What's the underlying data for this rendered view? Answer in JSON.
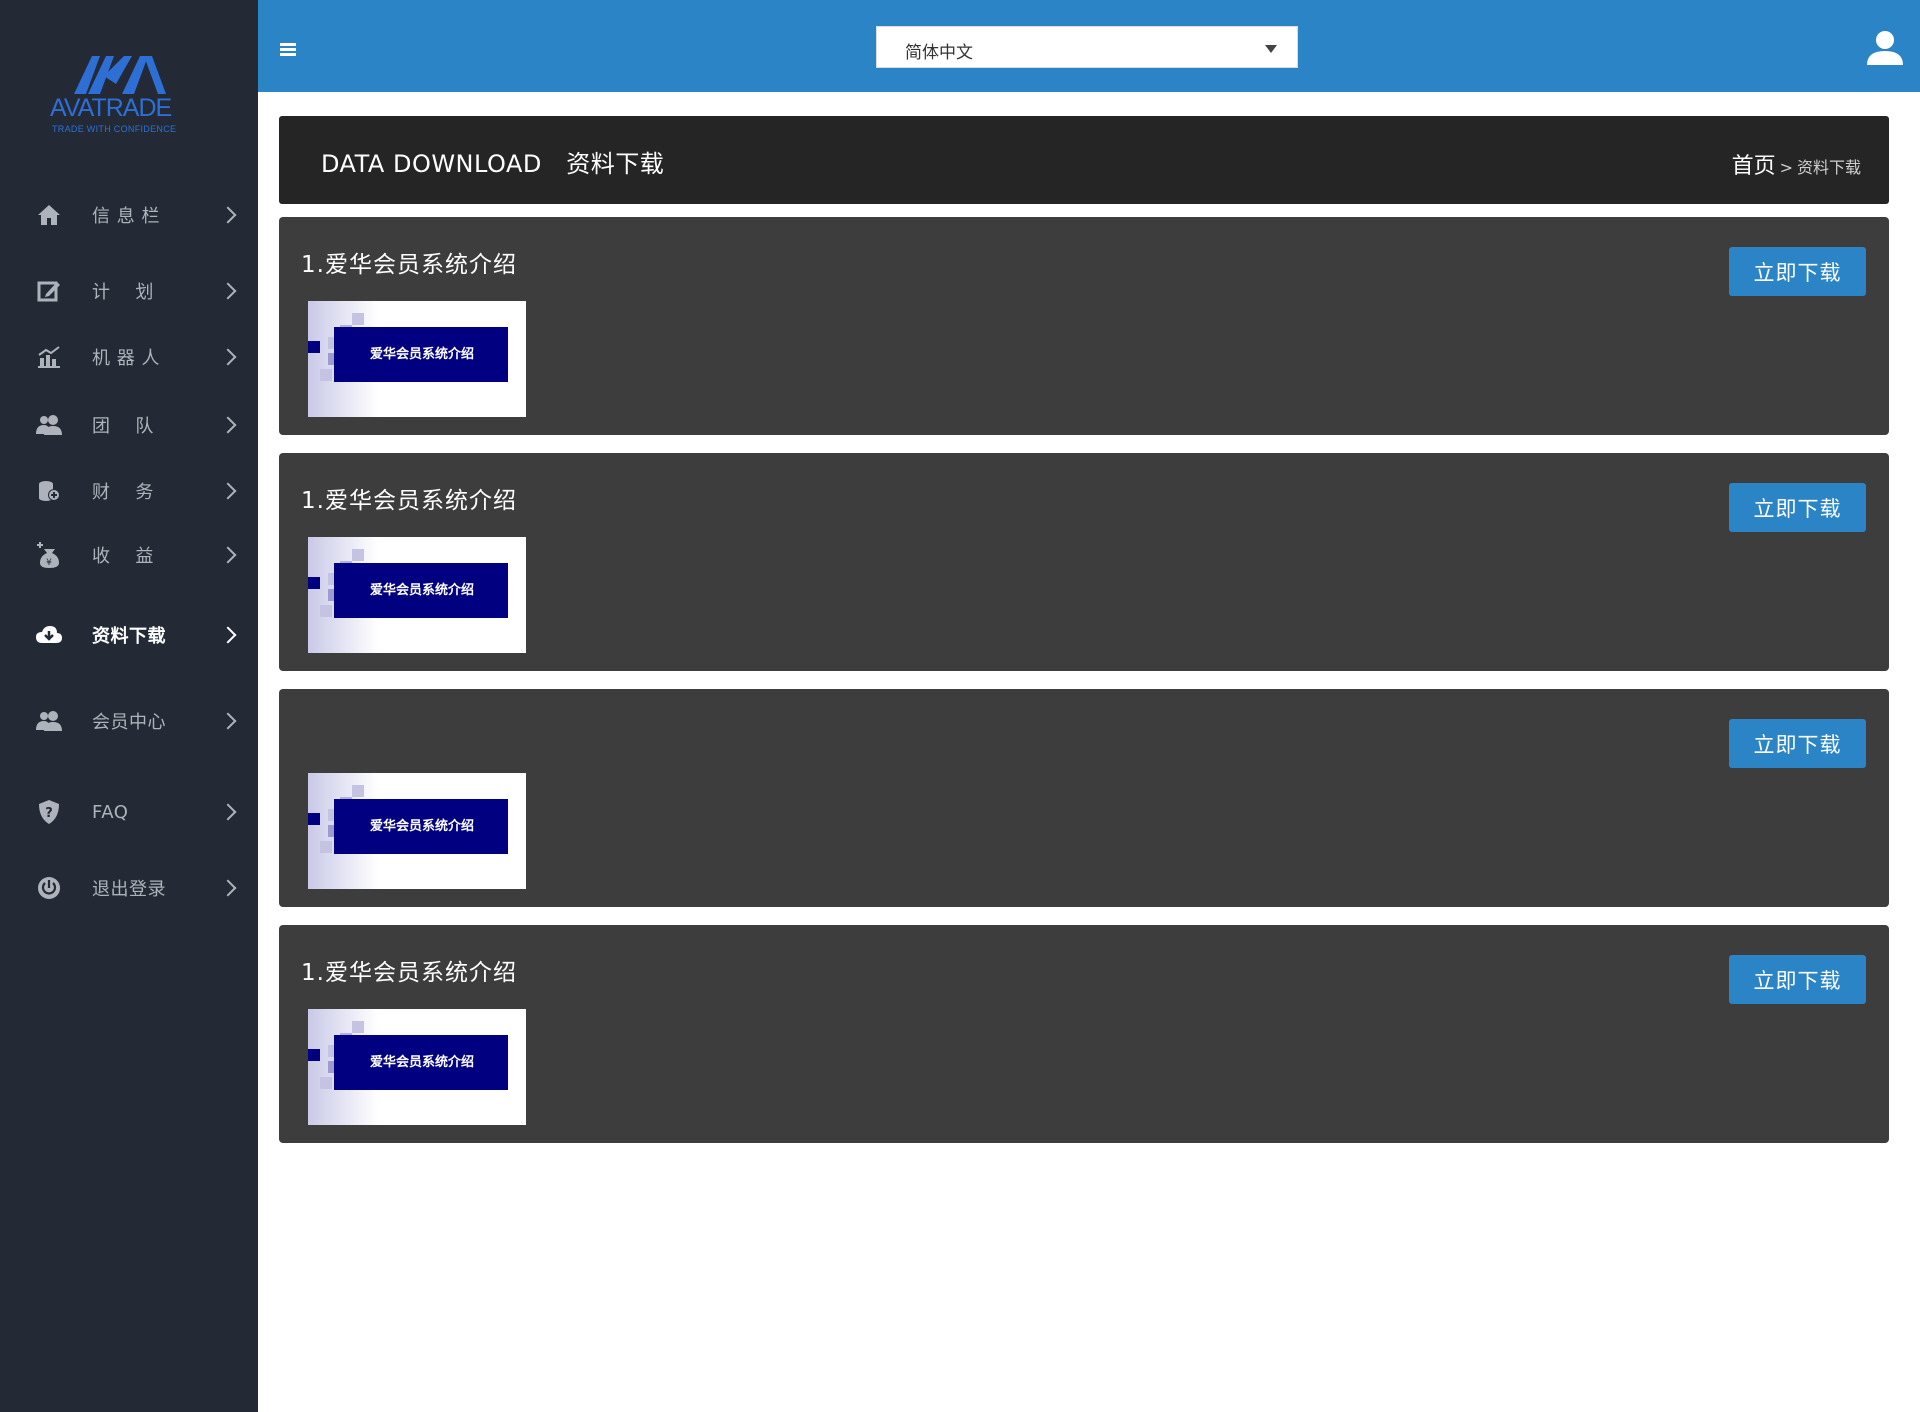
{
  "logo": {
    "brand": "AVATRADE",
    "tagline": "TRADE WITH CONFIDENCE",
    "color": "#2d6fd4"
  },
  "sidebar": {
    "items": [
      {
        "label": "信 息 栏",
        "icon": "home-icon"
      },
      {
        "label": "计    划",
        "icon": "edit-icon"
      },
      {
        "label": "机 器 人",
        "icon": "chart-icon"
      },
      {
        "label": "团    队",
        "icon": "team-icon"
      },
      {
        "label": "财    务",
        "icon": "finance-icon"
      },
      {
        "label": "收    益",
        "icon": "income-icon"
      },
      {
        "label": "资料下载",
        "icon": "cloud-download-icon",
        "active": true
      },
      {
        "label": "会员中心",
        "icon": "member-icon"
      },
      {
        "label": "FAQ",
        "icon": "shield-question-icon"
      },
      {
        "label": "退出登录",
        "icon": "power-icon"
      }
    ]
  },
  "topbar": {
    "language": "简体中文",
    "color": "#2a84c6"
  },
  "header": {
    "title_en": "DATA DOWNLOAD",
    "title_cn": "资料下载",
    "breadcrumb_home": "首页",
    "breadcrumb_sep": ">",
    "breadcrumb_current": "资料下载"
  },
  "cards": [
    {
      "title": "1.爱华会员系统介绍",
      "thumb_text": "爱华会员系统介绍",
      "button": "立即下载"
    },
    {
      "title": "1.爱华会员系统介绍",
      "thumb_text": "爱华会员系统介绍",
      "button": "立即下载"
    },
    {
      "title": "",
      "thumb_text": "爱华会员系统介绍",
      "button": "立即下载"
    },
    {
      "title": "1.爱华会员系统介绍",
      "thumb_text": "爱华会员系统介绍",
      "button": "立即下载"
    }
  ]
}
